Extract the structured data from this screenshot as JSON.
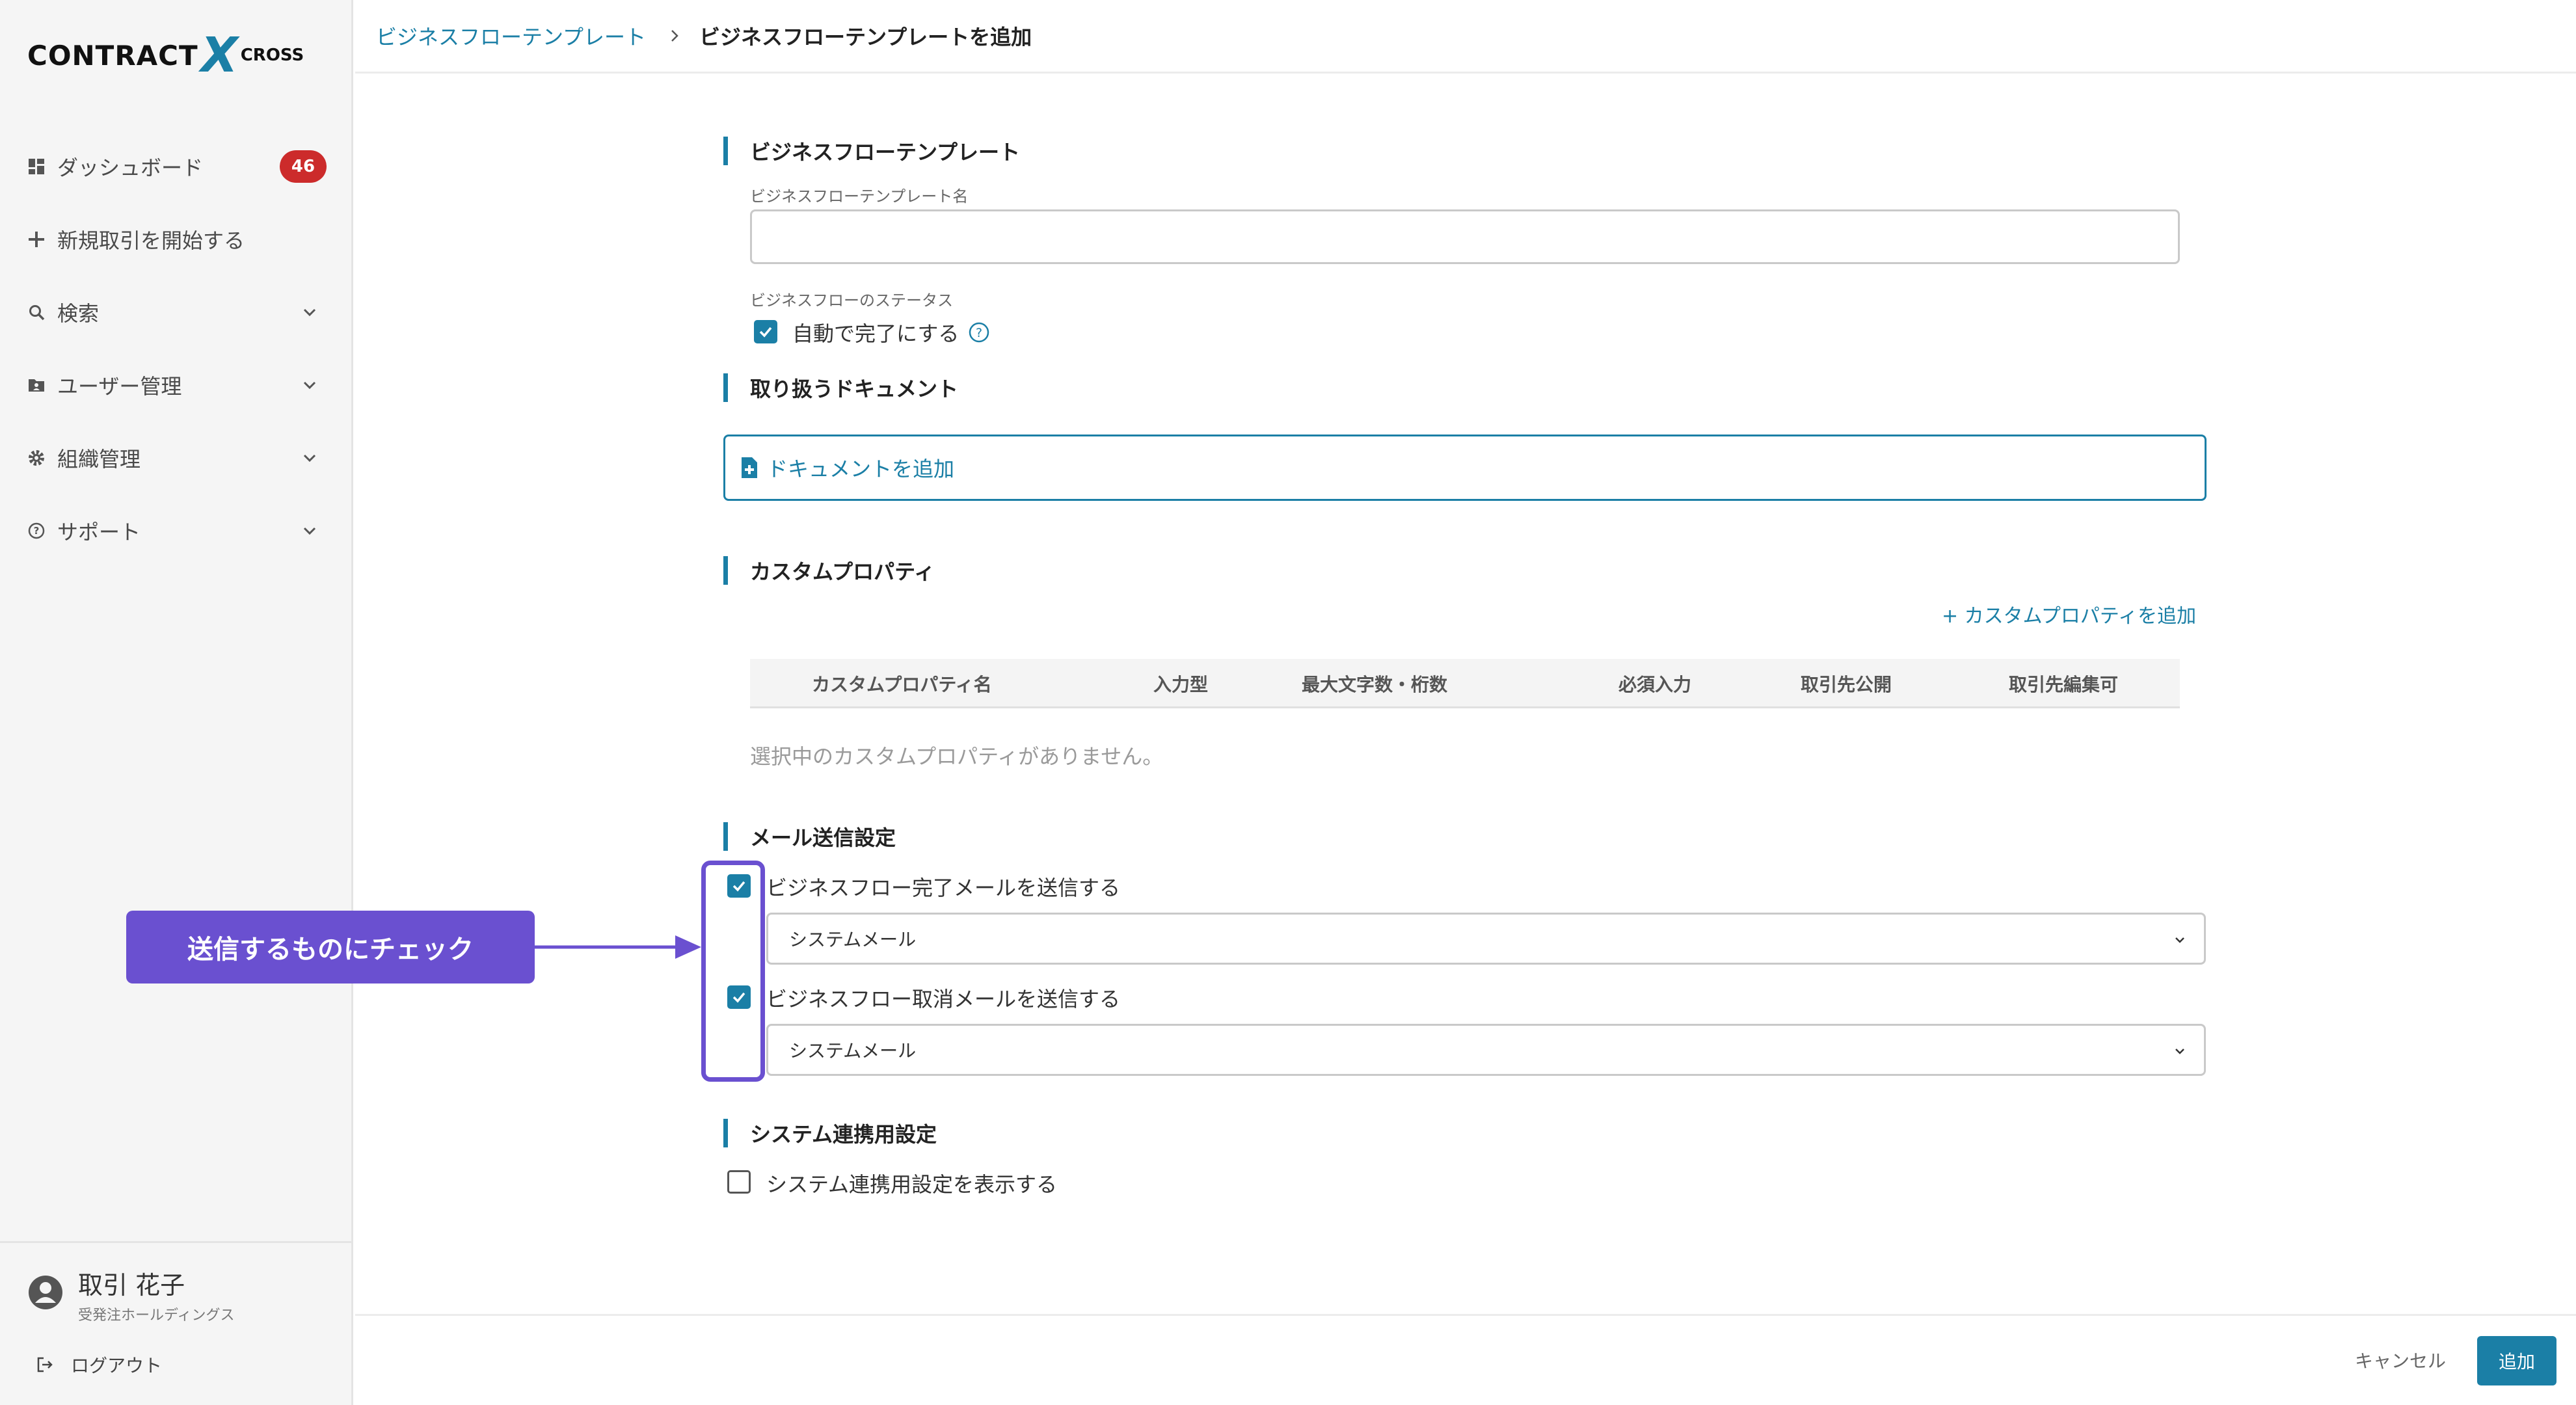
{
  "brand": {
    "logo_main": "CONTRACT",
    "logo_x": "X",
    "logo_sub": "CROSS",
    "accent": "#1b7fa6",
    "annotation_color": "#6a50d0",
    "badge_color": "#cc2b2b"
  },
  "sidebar": {
    "items": [
      {
        "label": "ダッシュボード",
        "icon": "dashboard-icon",
        "badge": "46"
      },
      {
        "label": "新規取引を開始する",
        "icon": "plus-icon"
      },
      {
        "label": "検索",
        "icon": "search-icon",
        "expandable": true
      },
      {
        "label": "ユーザー管理",
        "icon": "user-folder-icon",
        "expandable": true
      },
      {
        "label": "組織管理",
        "icon": "gear-icon",
        "expandable": true
      },
      {
        "label": "サポート",
        "icon": "help-icon",
        "expandable": true
      }
    ],
    "user": {
      "name": "取引 花子",
      "org": "受発注ホールディングス"
    },
    "logout_label": "ログアウト"
  },
  "header": {
    "breadcrumb_link": "ビジネスフローテンプレート",
    "breadcrumb_current": "ビジネスフローテンプレートを追加"
  },
  "form": {
    "template_section_title": "ビジネスフローテンプレート",
    "template_name_label": "ビジネスフローテンプレート名",
    "template_name_value": "",
    "status_label": "ビジネスフローのステータス",
    "auto_complete_label": "自動で完了にする",
    "auto_complete_checked": true,
    "documents_section_title": "取り扱うドキュメント",
    "add_document_label": "ドキュメントを追加",
    "custom_props_section_title": "カスタムプロパティ",
    "add_custom_prop_label": "+ カスタムプロパティを追加",
    "custom_props_columns": [
      "カスタムプロパティ名",
      "入力型",
      "最大文字数・桁数",
      "必須入力",
      "取引先公開",
      "取引先編集可"
    ],
    "custom_props_empty": "選択中のカスタムプロパティがありません。",
    "mail_section_title": "メール送信設定",
    "mail_complete_label": "ビジネスフロー完了メールを送信する",
    "mail_complete_checked": true,
    "mail_complete_select": "システムメール",
    "mail_cancel_label": "ビジネスフロー取消メールを送信する",
    "mail_cancel_checked": true,
    "mail_cancel_select": "システムメール",
    "system_section_title": "システム連携用設定",
    "system_show_label": "システム連携用設定を表示する",
    "system_show_checked": false
  },
  "annotation": {
    "callout_text": "送信するものにチェック"
  },
  "footer": {
    "cancel_label": "キャンセル",
    "submit_label": "追加"
  }
}
